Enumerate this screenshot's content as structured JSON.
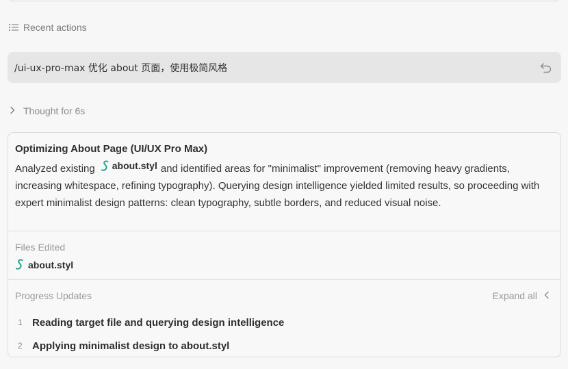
{
  "recent_actions": {
    "label": "Recent actions",
    "icon": "list-icon"
  },
  "prompt": {
    "text": "/ui-ux-pro-max 优化 about 页面，使用极简风格",
    "undo_icon": "undo-icon"
  },
  "thought": {
    "label": "Thought for 6s",
    "icon": "chevron-right-icon"
  },
  "summary": {
    "title": "Optimizing About Page (UI/UX Pro Max)",
    "body_before": "Analyzed existing",
    "file_chip": "about.styl",
    "body_after": "and identified areas for \"minimalist\" improvement (removing heavy gradients, increasing whitespace, refining typography). Querying design intelligence yielded limited results, so proceeding with expert minimalist design patterns: clean typography, subtle borders, and reduced visual noise."
  },
  "files_edited": {
    "label": "Files Edited",
    "files": [
      "about.styl"
    ],
    "file_icon": "stylus-icon",
    "file_icon_color": "#2aa198"
  },
  "progress": {
    "label": "Progress Updates",
    "expand_label": "Expand all",
    "expand_icon": "chevron-left-icon",
    "steps": [
      {
        "num": "1",
        "text": "Reading target file and querying design intelligence"
      },
      {
        "num": "2",
        "text": "Applying minimalist design to about.styl"
      }
    ]
  }
}
